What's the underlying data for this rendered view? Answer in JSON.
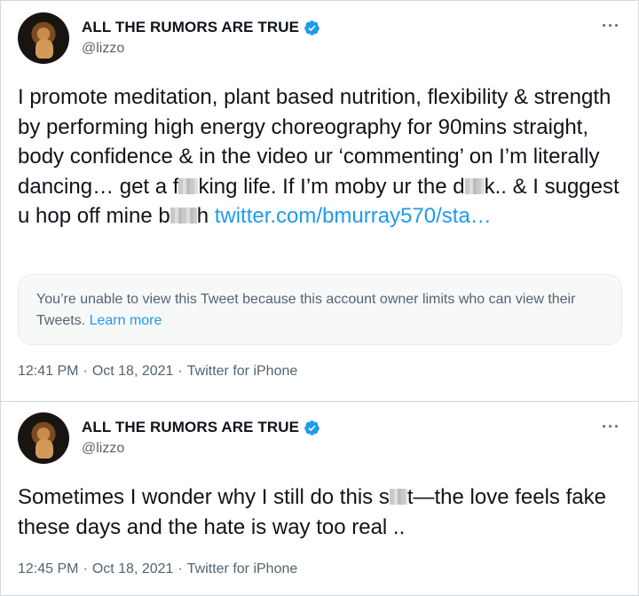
{
  "tweets": [
    {
      "display_name": "ALL THE RUMORS ARE TRUE",
      "handle": "@lizzo",
      "more": "···",
      "text_before_1": "I promote meditation, plant based nutrition, flexibility & strength by performing high energy choreography for 90mins straight, body confidence & in the video ur ‘commenting’ on I’m literally dancing… get a f",
      "text_after_1": "king life. If I’m moby ur the d",
      "text_after_2": "k.. & I suggest u hop off mine b",
      "text_after_3": "h ",
      "link": "twitter.com/bmurray570/sta…",
      "notice_text": "You’re unable to view this Tweet because this account owner limits who can view their Tweets. ",
      "notice_link": "Learn more",
      "time": "12:41 PM",
      "date": "Oct 18, 2021",
      "source": "Twitter for iPhone"
    },
    {
      "display_name": "ALL THE RUMORS ARE TRUE",
      "handle": "@lizzo",
      "more": "···",
      "text_before_1": "Sometimes I wonder why I still do this s",
      "text_after_1": "t—the love feels fake these days and the hate is way too real ..",
      "time": "12:45 PM",
      "date": "Oct 18, 2021",
      "source": "Twitter for iPhone"
    }
  ],
  "meta_separator": "·",
  "colors": {
    "link": "#1d9bf0",
    "verified": "#1d9bf0",
    "muted": "#536471"
  },
  "icons": {
    "verified": "verified-badge-icon",
    "more": "more-options-icon"
  }
}
